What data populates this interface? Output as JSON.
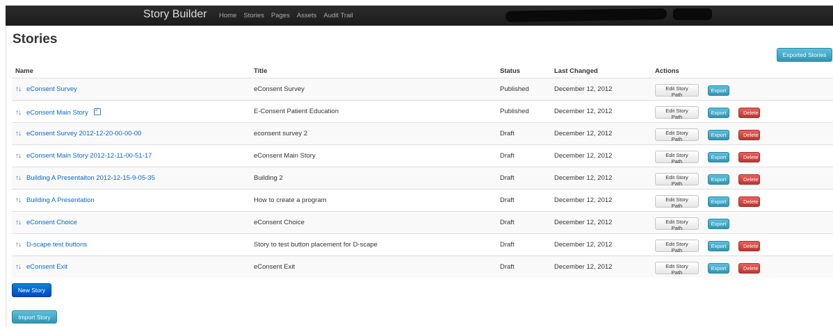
{
  "app": {
    "brand": "Story Builder",
    "nav": [
      "Home",
      "Stories",
      "Pages",
      "Assets",
      "Audit Trail"
    ]
  },
  "page": {
    "title": "Stories",
    "exported_button": "Exported Stories",
    "new_story_button": "New Story",
    "import_story_button": "Import Story"
  },
  "table": {
    "headers": {
      "name": "Name",
      "title": "Title",
      "status": "Status",
      "changed": "Last Changed",
      "actions": "Actions"
    },
    "action_labels": {
      "edit": "Edit Story Path",
      "export": "Export",
      "delete": "Delete"
    },
    "rows": [
      {
        "name": "eConsent Survey",
        "title": "eConsent Survey",
        "status": "Published",
        "changed": "December 12, 2012",
        "checked": false,
        "delete": false
      },
      {
        "name": "eConsent Main Story",
        "title": "E-Consent Patient Education",
        "status": "Published",
        "changed": "December 12, 2012",
        "checked": true,
        "delete": true
      },
      {
        "name": "eConsent Survey 2012-12-20-00-00-00",
        "title": "econsent survey 2",
        "status": "Draft",
        "changed": "December 12, 2012",
        "checked": false,
        "delete": true
      },
      {
        "name": "eConsent Main Story 2012-12-11-00-51-17",
        "title": "eConsent Main Story",
        "status": "Draft",
        "changed": "December 12, 2012",
        "checked": false,
        "delete": true
      },
      {
        "name": "Building A Presentaiton 2012-12-15-9-05-35",
        "title": "Building 2",
        "status": "Draft",
        "changed": "December 12, 2012",
        "checked": false,
        "delete": true
      },
      {
        "name": "Building A Presentation",
        "title": "How to create a program",
        "status": "Draft",
        "changed": "December 12, 2012",
        "checked": false,
        "delete": true
      },
      {
        "name": "eConsent Choice",
        "title": "eConsent Choice",
        "status": "Draft",
        "changed": "December 12, 2012",
        "checked": false,
        "delete": false
      },
      {
        "name": "D-scape test buttons",
        "title": "Story to test button placement for D-scape",
        "status": "Draft",
        "changed": "December 12, 2012",
        "checked": false,
        "delete": true
      },
      {
        "name": "eConsent Exit",
        "title": "eConsent Exit",
        "status": "Draft",
        "changed": "December 12, 2012",
        "checked": false,
        "delete": true
      }
    ]
  },
  "icons": {
    "reorder": "up-down-arrows-icon",
    "checked": "checkbox-checked-icon"
  },
  "colors": {
    "navbar": "#1b1b1b",
    "link": "#0a68c8",
    "info": "#2f96b4",
    "primary": "#0044cc",
    "danger": "#bd362f"
  }
}
